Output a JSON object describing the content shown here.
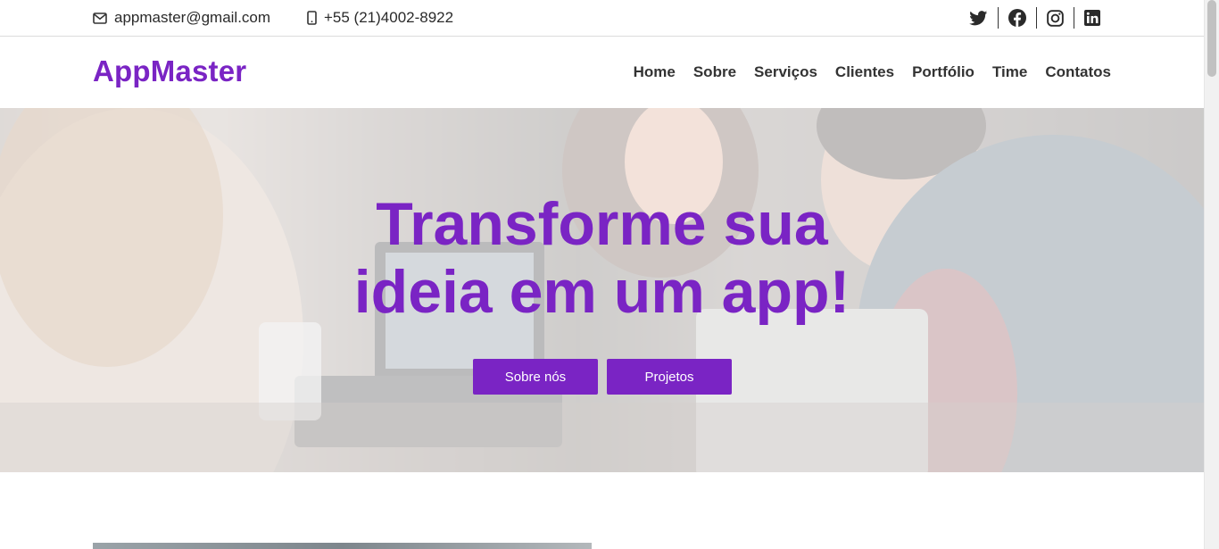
{
  "topbar": {
    "email": "appmaster@gmail.com",
    "phone": "+55 (21)4002-8922",
    "socials": [
      "twitter-icon",
      "facebook-icon",
      "instagram-icon",
      "linkedin-icon"
    ]
  },
  "navbar": {
    "brand": "AppMaster",
    "menu": [
      "Home",
      "Sobre",
      "Serviços",
      "Clientes",
      "Portfólio",
      "Time",
      "Contatos"
    ]
  },
  "hero": {
    "title_line1": "Transforme sua",
    "title_line2": "ideia em um app!",
    "buttons": [
      "Sobre nós",
      "Projetos"
    ]
  },
  "colors": {
    "accent": "#7a24c4",
    "text": "#333333"
  }
}
